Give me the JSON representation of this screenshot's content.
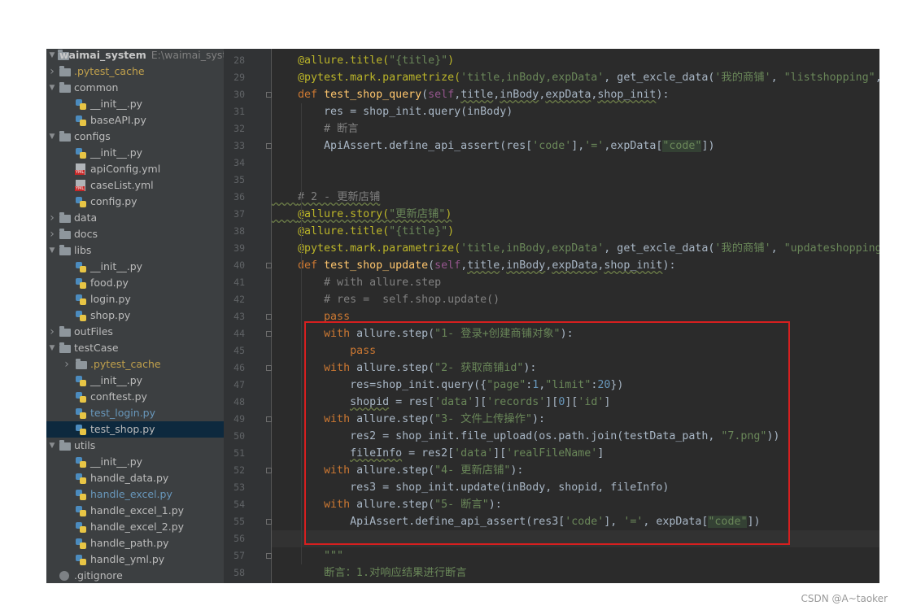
{
  "project": {
    "name": "waimai_system",
    "path": "E:\\waimai_system"
  },
  "tree": [
    {
      "label": ".pytest_cache",
      "type": "folder",
      "depth": 0,
      "arrow": "right",
      "style": "cache"
    },
    {
      "label": "common",
      "type": "folder",
      "depth": 0,
      "arrow": "down"
    },
    {
      "label": "__init__.py",
      "type": "py",
      "depth": 1
    },
    {
      "label": "baseAPI.py",
      "type": "py",
      "depth": 1
    },
    {
      "label": "configs",
      "type": "folder",
      "depth": 0,
      "arrow": "down"
    },
    {
      "label": "__init__.py",
      "type": "py",
      "depth": 1
    },
    {
      "label": "apiConfig.yml",
      "type": "yml",
      "depth": 1
    },
    {
      "label": "caseList.yml",
      "type": "yml",
      "depth": 1
    },
    {
      "label": "config.py",
      "type": "py",
      "depth": 1
    },
    {
      "label": "data",
      "type": "folder",
      "depth": 0,
      "arrow": "right"
    },
    {
      "label": "docs",
      "type": "folder",
      "depth": 0,
      "arrow": "right"
    },
    {
      "label": "libs",
      "type": "folder",
      "depth": 0,
      "arrow": "down"
    },
    {
      "label": "__init__.py",
      "type": "py",
      "depth": 1
    },
    {
      "label": "food.py",
      "type": "py",
      "depth": 1
    },
    {
      "label": "login.py",
      "type": "py",
      "depth": 1
    },
    {
      "label": "shop.py",
      "type": "py",
      "depth": 1
    },
    {
      "label": "outFiles",
      "type": "folder",
      "depth": 0,
      "arrow": "right"
    },
    {
      "label": "testCase",
      "type": "folder",
      "depth": 0,
      "arrow": "down"
    },
    {
      "label": ".pytest_cache",
      "type": "folder",
      "depth": 1,
      "arrow": "right",
      "style": "cache"
    },
    {
      "label": "__init__.py",
      "type": "py",
      "depth": 1
    },
    {
      "label": "conftest.py",
      "type": "py",
      "depth": 1
    },
    {
      "label": "test_login.py",
      "type": "py",
      "depth": 1,
      "style": "modified"
    },
    {
      "label": "test_shop.py",
      "type": "py",
      "depth": 1,
      "selected": true
    },
    {
      "label": "utils",
      "type": "folder",
      "depth": 0,
      "arrow": "down"
    },
    {
      "label": "__init__.py",
      "type": "py",
      "depth": 1
    },
    {
      "label": "handle_data.py",
      "type": "py",
      "depth": 1
    },
    {
      "label": "handle_excel.py",
      "type": "py",
      "depth": 1,
      "style": "modified"
    },
    {
      "label": "handle_excel_1.py",
      "type": "py",
      "depth": 1
    },
    {
      "label": "handle_excel_2.py",
      "type": "py",
      "depth": 1
    },
    {
      "label": "handle_path.py",
      "type": "py",
      "depth": 1
    },
    {
      "label": "handle_yml.py",
      "type": "py",
      "depth": 1
    },
    {
      "label": ".gitignore",
      "type": "git",
      "depth": 0
    }
  ],
  "editor": {
    "current_line": 56,
    "lines": [
      {
        "n": "28",
        "tokens": [
          [
            "    ",
            ""
          ],
          [
            "@allure.title(",
            "dec"
          ],
          [
            "\"{title}\"",
            "str"
          ],
          [
            ")",
            "dec"
          ]
        ]
      },
      {
        "n": "29",
        "tokens": [
          [
            "    ",
            ""
          ],
          [
            "@pytest.mark.parametrize(",
            "dec"
          ],
          [
            "'title,inBody,expData'",
            "str"
          ],
          [
            ", get_excle_data(",
            ""
          ],
          [
            "'我的商铺'",
            "str"
          ],
          [
            ", ",
            ""
          ],
          [
            "\"listshopping\"",
            "str"
          ],
          [
            ",",
            ""
          ]
        ]
      },
      {
        "n": "30",
        "tokens": [
          [
            "    ",
            ""
          ],
          [
            "def ",
            "kw"
          ],
          [
            "test_shop_query",
            "fn"
          ],
          [
            "(",
            ""
          ],
          [
            "self",
            "sf"
          ],
          [
            ",",
            ""
          ],
          [
            "title",
            ""
          ],
          [
            ",",
            ""
          ],
          [
            "inBody",
            ""
          ],
          [
            ",",
            ""
          ],
          [
            "expData",
            ""
          ],
          [
            ",",
            ""
          ],
          [
            "shop_init",
            ""
          ],
          [
            "):",
            ""
          ]
        ]
      },
      {
        "n": "31",
        "tokens": [
          [
            "        res = shop_init.query(inBody)",
            ""
          ]
        ]
      },
      {
        "n": "32",
        "tokens": [
          [
            "        ",
            ""
          ],
          [
            "# 断言",
            "cm"
          ]
        ]
      },
      {
        "n": "33",
        "tokens": [
          [
            "        ApiAssert.define_api_assert(res[",
            ""
          ],
          [
            "'code'",
            "str"
          ],
          [
            "]",
            ""
          ],
          [
            ",",
            ""
          ],
          [
            "'='",
            "str"
          ],
          [
            ",",
            ""
          ],
          [
            "expData[",
            ""
          ],
          [
            "\"code\"",
            "str"
          ],
          [
            "])",
            ""
          ]
        ]
      },
      {
        "n": "34",
        "tokens": []
      },
      {
        "n": "35",
        "tokens": []
      },
      {
        "n": "36",
        "tokens": [
          [
            "    ",
            ""
          ],
          [
            "# 2 - 更新店铺",
            "cm"
          ]
        ]
      },
      {
        "n": "37",
        "tokens": [
          [
            "    ",
            ""
          ],
          [
            "@allure.story(",
            "dec"
          ],
          [
            "\"更新店铺\"",
            "str"
          ],
          [
            ")",
            "dec"
          ]
        ]
      },
      {
        "n": "38",
        "tokens": [
          [
            "    ",
            ""
          ],
          [
            "@allure.title(",
            "dec"
          ],
          [
            "\"{title}\"",
            "str"
          ],
          [
            ")",
            "dec"
          ]
        ]
      },
      {
        "n": "39",
        "tokens": [
          [
            "    ",
            ""
          ],
          [
            "@pytest.mark.parametrize(",
            "dec"
          ],
          [
            "'title,inBody,expData'",
            "str"
          ],
          [
            ", get_excle_data(",
            ""
          ],
          [
            "'我的商铺'",
            "str"
          ],
          [
            ", ",
            ""
          ],
          [
            "\"updateshopping\"",
            "str"
          ]
        ]
      },
      {
        "n": "40",
        "tokens": [
          [
            "    ",
            ""
          ],
          [
            "def ",
            "kw"
          ],
          [
            "test_shop_update",
            "fn"
          ],
          [
            "(",
            ""
          ],
          [
            "self",
            "sf"
          ],
          [
            ",",
            ""
          ],
          [
            "title",
            ""
          ],
          [
            ",",
            ""
          ],
          [
            "inBody",
            ""
          ],
          [
            ",",
            ""
          ],
          [
            "expData",
            ""
          ],
          [
            ",",
            ""
          ],
          [
            "shop_init",
            ""
          ],
          [
            "):",
            ""
          ]
        ]
      },
      {
        "n": "41",
        "tokens": [
          [
            "        ",
            ""
          ],
          [
            "# with allure.step",
            "cm"
          ]
        ]
      },
      {
        "n": "42",
        "tokens": [
          [
            "        ",
            ""
          ],
          [
            "# res =  self.shop.update()",
            "cm"
          ]
        ]
      },
      {
        "n": "43",
        "tokens": [
          [
            "        ",
            ""
          ],
          [
            "pass",
            "kw"
          ]
        ]
      },
      {
        "n": "44",
        "tokens": [
          [
            "        ",
            ""
          ],
          [
            "with ",
            "kw"
          ],
          [
            "allure.step(",
            ""
          ],
          [
            "\"1- 登录+创建商铺对象\"",
            "str"
          ],
          [
            "):",
            ""
          ]
        ]
      },
      {
        "n": "45",
        "tokens": [
          [
            "            ",
            ""
          ],
          [
            "pass",
            "kw"
          ]
        ]
      },
      {
        "n": "46",
        "tokens": [
          [
            "        ",
            ""
          ],
          [
            "with ",
            "kw"
          ],
          [
            "allure.step(",
            ""
          ],
          [
            "\"2- 获取商铺id\"",
            "str"
          ],
          [
            "):",
            ""
          ]
        ]
      },
      {
        "n": "47",
        "tokens": [
          [
            "            res=shop_init.query({",
            ""
          ],
          [
            "\"page\"",
            "str"
          ],
          [
            ":",
            ""
          ],
          [
            "1",
            "num"
          ],
          [
            ",",
            ""
          ],
          [
            "\"limit\"",
            "str"
          ],
          [
            ":",
            ""
          ],
          [
            "20",
            "num"
          ],
          [
            "})",
            ""
          ]
        ]
      },
      {
        "n": "48",
        "tokens": [
          [
            "            ",
            ""
          ],
          [
            "shopid",
            ""
          ],
          [
            " = res[",
            ""
          ],
          [
            "'data'",
            "str"
          ],
          [
            "][",
            ""
          ],
          [
            "'records'",
            "str"
          ],
          [
            "][",
            ""
          ],
          [
            "0",
            "num"
          ],
          [
            "][",
            ""
          ],
          [
            "'id'",
            "str"
          ],
          [
            "]",
            ""
          ]
        ]
      },
      {
        "n": "49",
        "tokens": [
          [
            "        ",
            ""
          ],
          [
            "with ",
            "kw"
          ],
          [
            "allure.step(",
            ""
          ],
          [
            "\"3- 文件上传操作\"",
            "str"
          ],
          [
            "):",
            ""
          ]
        ]
      },
      {
        "n": "50",
        "tokens": [
          [
            "            res2 = shop_init.file_upload(os.path.join(testData_path, ",
            ""
          ],
          [
            "\"7.png\"",
            "str"
          ],
          [
            "))",
            ""
          ]
        ]
      },
      {
        "n": "51",
        "tokens": [
          [
            "            ",
            ""
          ],
          [
            "fileInfo",
            ""
          ],
          [
            " = res2[",
            ""
          ],
          [
            "'data'",
            "str"
          ],
          [
            "][",
            ""
          ],
          [
            "'realFileName'",
            "str"
          ],
          [
            "]",
            ""
          ]
        ]
      },
      {
        "n": "52",
        "tokens": [
          [
            "        ",
            ""
          ],
          [
            "with ",
            "kw"
          ],
          [
            "allure.step(",
            ""
          ],
          [
            "\"4- 更新店铺\"",
            "str"
          ],
          [
            "):",
            ""
          ]
        ]
      },
      {
        "n": "53",
        "tokens": [
          [
            "            res3 = shop_init.update(inBody, shopid, fileInfo)",
            ""
          ]
        ]
      },
      {
        "n": "54",
        "tokens": [
          [
            "        ",
            ""
          ],
          [
            "with ",
            "kw"
          ],
          [
            "allure.step(",
            ""
          ],
          [
            "\"5- 断言\"",
            "str"
          ],
          [
            "):",
            ""
          ]
        ]
      },
      {
        "n": "55",
        "tokens": [
          [
            "            ApiAssert.define_api_assert(res3[",
            ""
          ],
          [
            "'code'",
            "str"
          ],
          [
            "], ",
            ""
          ],
          [
            "'='",
            "str"
          ],
          [
            ", expData[",
            ""
          ],
          [
            "\"code\"",
            "str"
          ],
          [
            "])",
            ""
          ]
        ]
      },
      {
        "n": "56",
        "tokens": []
      },
      {
        "n": "57",
        "tokens": [
          [
            "        ",
            ""
          ],
          [
            "\"\"\"",
            "str"
          ]
        ]
      },
      {
        "n": "58",
        "tokens": [
          [
            "        ",
            ""
          ],
          [
            "断言：1.对响应结果进行断言",
            "str"
          ]
        ]
      }
    ]
  },
  "watermark": "CSDN @A~taoker"
}
